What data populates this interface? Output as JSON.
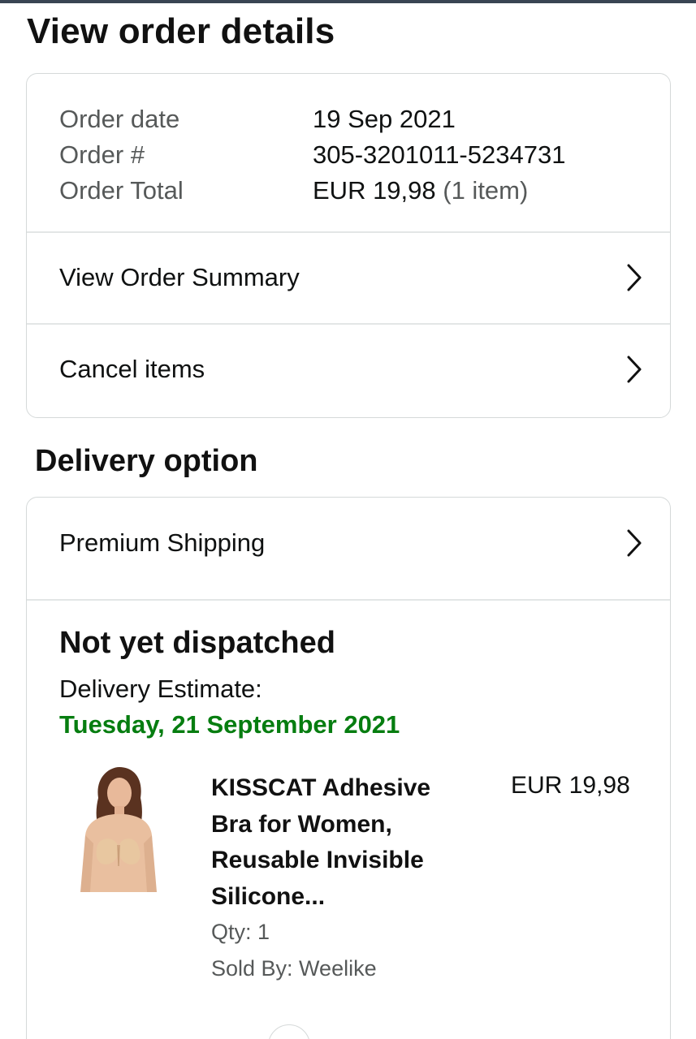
{
  "page": {
    "title": "View order details"
  },
  "order_info": {
    "rows": [
      {
        "label": "Order date",
        "value": "19 Sep 2021",
        "extra": ""
      },
      {
        "label": "Order #",
        "value": "305-3201011-5234731",
        "extra": ""
      },
      {
        "label": "Order Total",
        "value": "EUR 19,98",
        "extra": " (1 item)"
      }
    ]
  },
  "order_actions": {
    "summary_label": "View Order Summary",
    "cancel_label": "Cancel items"
  },
  "delivery": {
    "section_title": "Delivery option",
    "shipping_label": "Premium Shipping",
    "status": "Not yet dispatched",
    "estimate_label": "Delivery Estimate:",
    "estimate_date": "Tuesday, 21 September 2021"
  },
  "product": {
    "title": "KISSCAT Adhesive Bra for Women, Reusable Invisible Silicone...",
    "price": "EUR 19,98",
    "qty": "Qty: 1",
    "seller": "Sold By: Weelike"
  },
  "colors": {
    "estimate_green": "#067d10",
    "border": "#d5d9d9",
    "muted_text": "#565959"
  },
  "icons": {
    "chevron": "chevron-right-icon",
    "product_image": "product-thumbnail"
  }
}
